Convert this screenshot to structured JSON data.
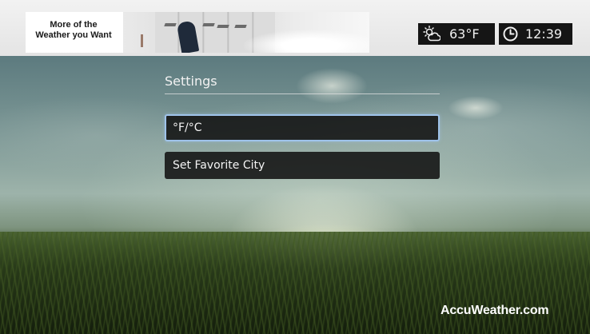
{
  "top_bar": {
    "ad": {
      "line1": "More of the",
      "line2": "Weather you Want"
    },
    "weather": {
      "icon": "sun-cloud-icon",
      "temperature": "63°F"
    },
    "clock": {
      "icon": "clock-icon",
      "time": "12:39"
    }
  },
  "settings": {
    "title": "Settings",
    "items": [
      {
        "label": "°F/°C",
        "selected": true
      },
      {
        "label": "Set Favorite City",
        "selected": false
      }
    ]
  },
  "branding": {
    "logo_text": "AccuWeather.com"
  },
  "colors": {
    "selection_border": "#9fc3ea",
    "menu_background": "#121212",
    "status_box": "#151515"
  }
}
